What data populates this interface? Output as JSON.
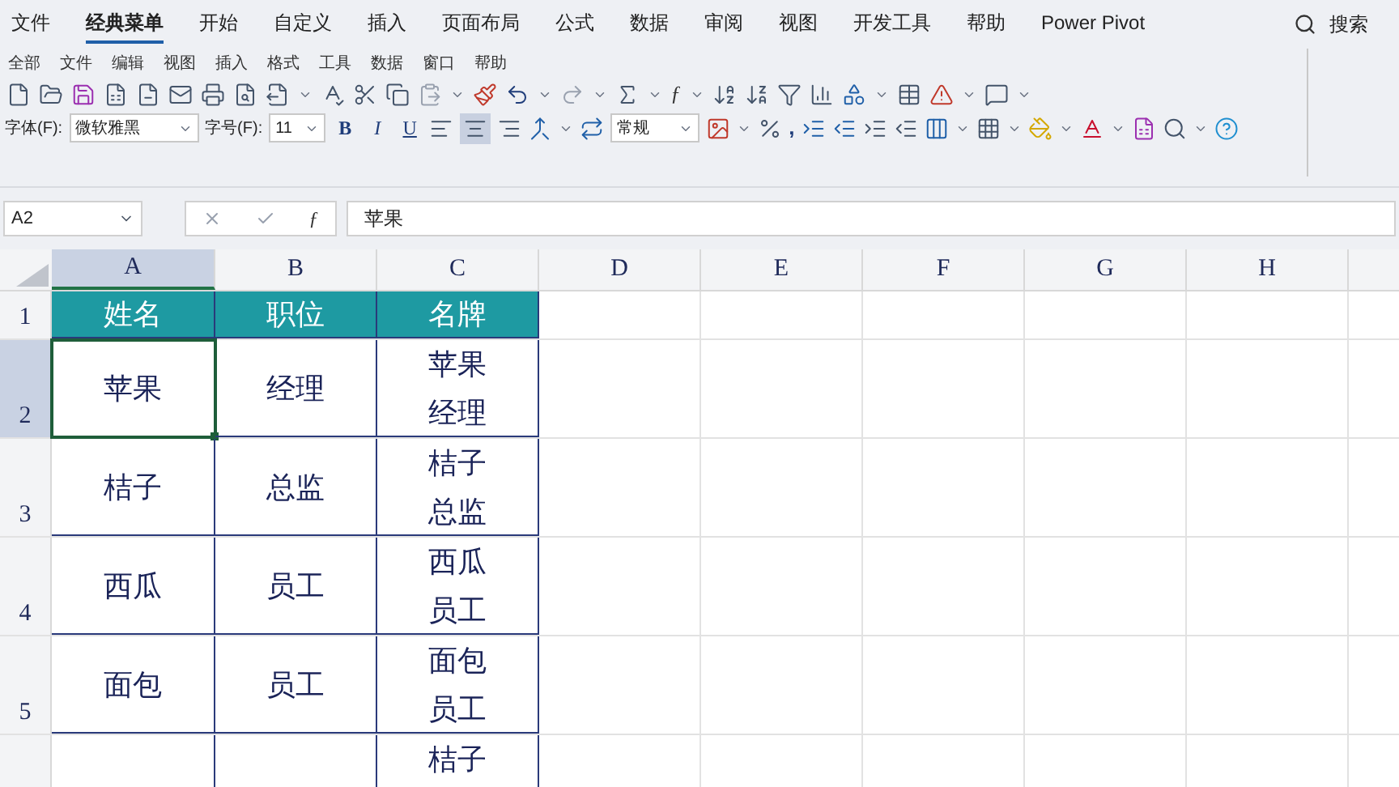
{
  "menu_tabs": [
    {
      "label": "文件",
      "selected": false
    },
    {
      "label": "经典菜单",
      "selected": true
    },
    {
      "label": "开始",
      "selected": false
    },
    {
      "label": "自定义",
      "selected": false
    },
    {
      "label": "插入",
      "selected": false
    },
    {
      "label": "页面布局",
      "selected": false
    },
    {
      "label": "公式",
      "selected": false
    },
    {
      "label": "数据",
      "selected": false
    },
    {
      "label": "审阅",
      "selected": false
    },
    {
      "label": "视图",
      "selected": false
    },
    {
      "label": "开发工具",
      "selected": false
    },
    {
      "label": "帮助",
      "selected": false
    },
    {
      "label": "Power Pivot",
      "selected": false
    }
  ],
  "search": {
    "label": "搜索"
  },
  "classic_menus": [
    "全部",
    "文件",
    "编辑",
    "视图",
    "插入",
    "格式",
    "工具",
    "数据",
    "窗口",
    "帮助"
  ],
  "font": {
    "label": "字体(F):",
    "value": "微软雅黑"
  },
  "font_size": {
    "label": "字号(F):",
    "value": "11"
  },
  "style_buttons": [
    {
      "label": "B",
      "kind": "bold"
    },
    {
      "label": "I",
      "kind": "italic"
    },
    {
      "label": "U",
      "kind": "underline"
    }
  ],
  "number_format": {
    "value": "常规"
  },
  "function_glyph": "ƒ",
  "formula_function_glyph": "ƒ",
  "comma_style": ",",
  "formula_bar": {
    "name_box": "A2",
    "value": "苹果"
  },
  "columns": [
    {
      "label": "A",
      "selected": true
    },
    {
      "label": "B",
      "selected": false
    },
    {
      "label": "C",
      "selected": false
    },
    {
      "label": "D",
      "selected": false
    },
    {
      "label": "E",
      "selected": false
    },
    {
      "label": "F",
      "selected": false
    },
    {
      "label": "G",
      "selected": false
    },
    {
      "label": "H",
      "selected": false
    }
  ],
  "rows": [
    {
      "number": "1",
      "kind": "header",
      "selected": false,
      "cells": [
        [
          "姓名"
        ],
        [
          "职位"
        ],
        [
          "名牌"
        ]
      ]
    },
    {
      "number": "2",
      "kind": "data",
      "selected": true,
      "cells": [
        [
          "苹果"
        ],
        [
          "经理"
        ],
        [
          "苹果",
          "经理"
        ]
      ]
    },
    {
      "number": "3",
      "kind": "data",
      "selected": false,
      "cells": [
        [
          "桔子"
        ],
        [
          "总监"
        ],
        [
          "桔子",
          "总监"
        ]
      ]
    },
    {
      "number": "4",
      "kind": "data",
      "selected": false,
      "cells": [
        [
          "西瓜"
        ],
        [
          "员工"
        ],
        [
          "西瓜",
          "员工"
        ]
      ]
    },
    {
      "number": "5",
      "kind": "data",
      "selected": false,
      "cells": [
        [
          "面包"
        ],
        [
          "员工"
        ],
        [
          "面包",
          "员工"
        ]
      ]
    },
    {
      "kind": "data",
      "selected": false,
      "cells": [
        null,
        null,
        [
          "桔子"
        ]
      ]
    }
  ]
}
